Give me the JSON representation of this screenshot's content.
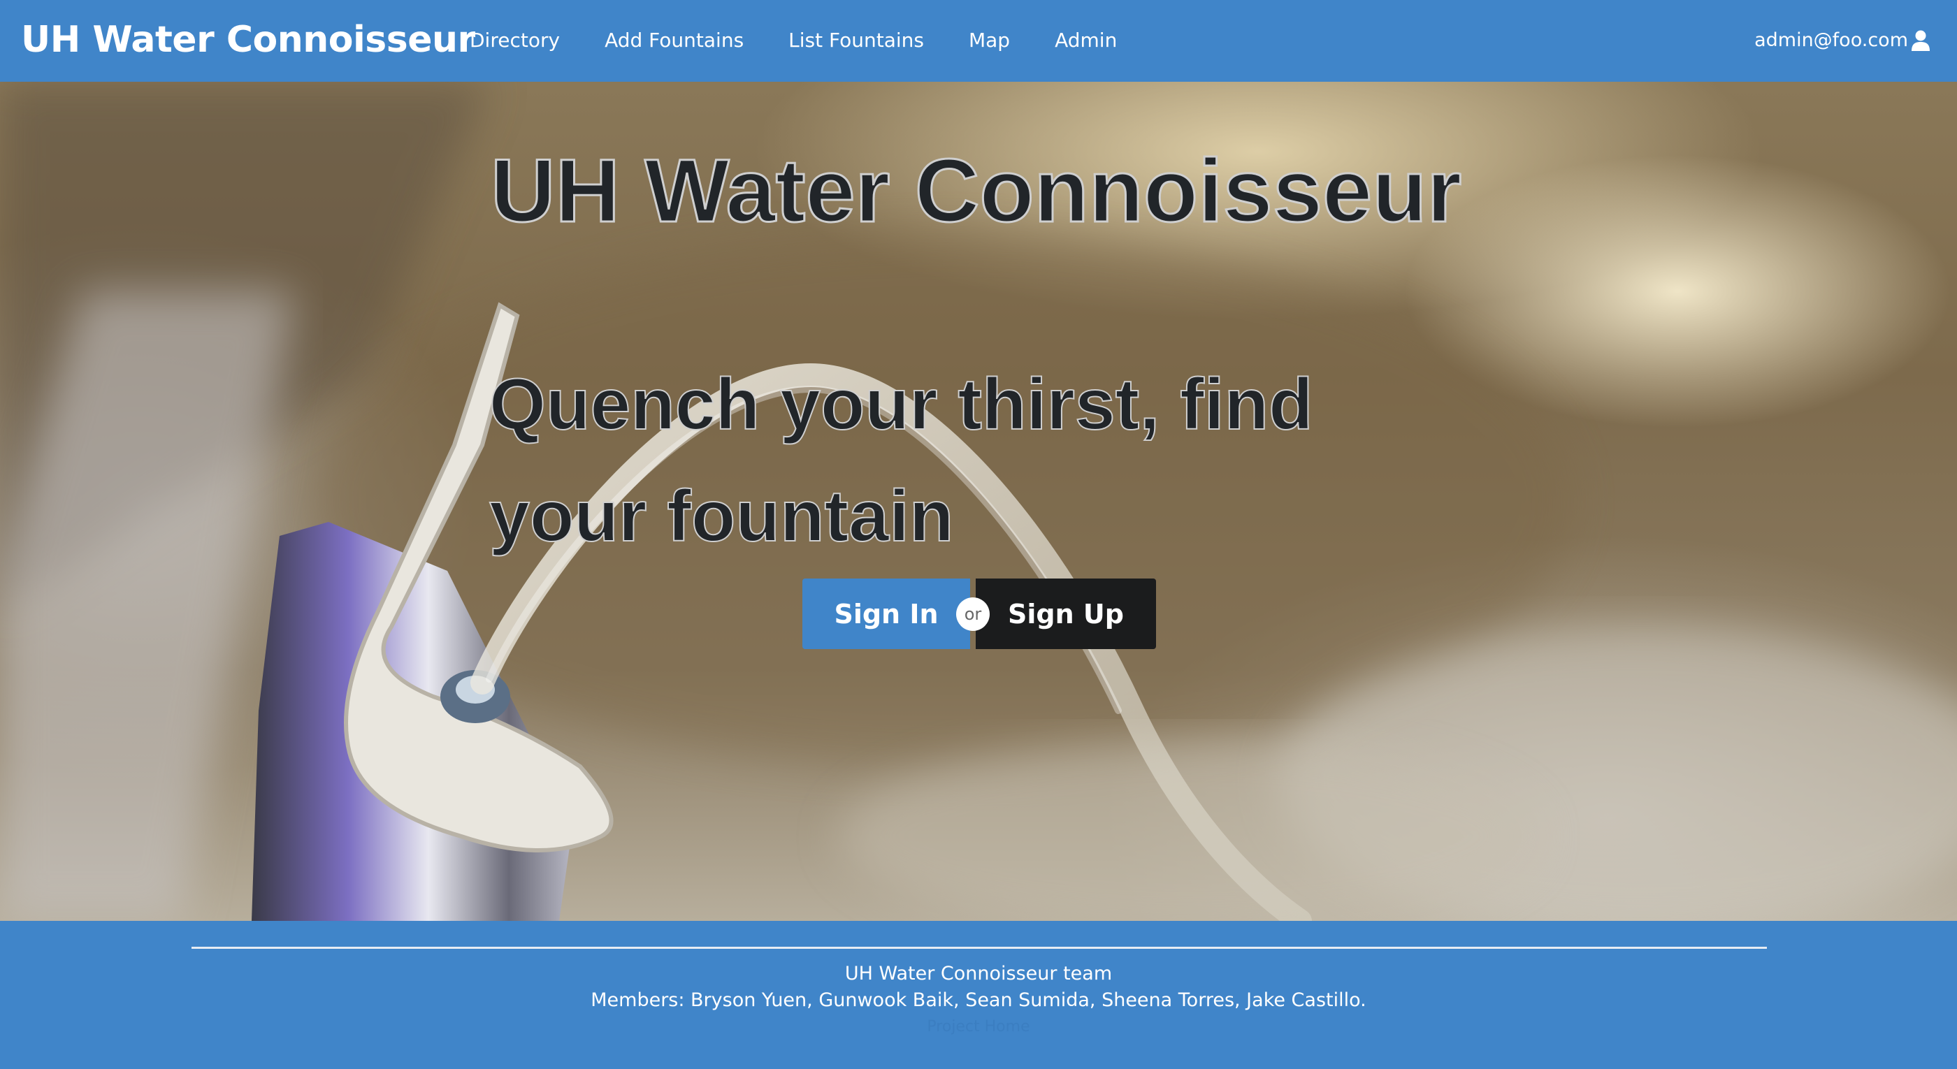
{
  "navbar": {
    "brand": "UH Water Connoisseur",
    "links": [
      "Directory",
      "Add Fountains",
      "List Fountains",
      "Map",
      "Admin"
    ],
    "user": "admin@foo.com",
    "user_icon": "user-icon"
  },
  "hero": {
    "title": "UH Water Connoisseur",
    "subtitle": "Quench your thirst, find your fountain",
    "signin_label": "Sign In",
    "or_label": "or",
    "signup_label": "Sign Up"
  },
  "footer": {
    "team": "UH Water Connoisseur team",
    "members": "Members: Bryson Yuen, Gunwook Baik, Sean Sumida, Sheena Torres, Jake Castillo.",
    "project_link": "Project Home"
  },
  "colors": {
    "primary": "#4085c9",
    "dark_button": "#1b1c1d",
    "text_dark": "#212529"
  }
}
